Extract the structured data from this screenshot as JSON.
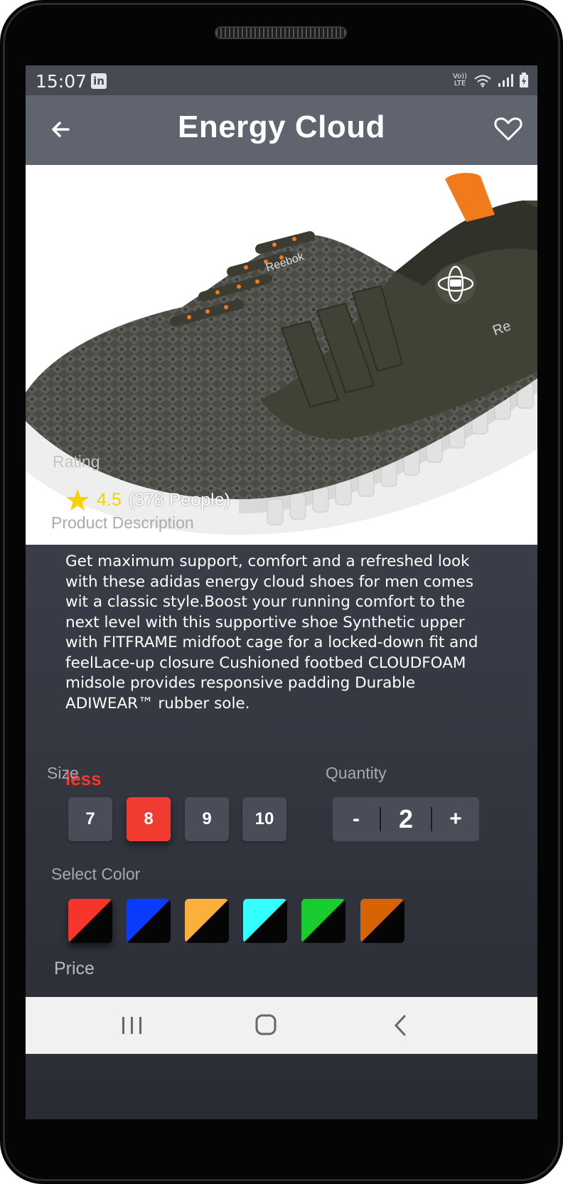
{
  "status_bar": {
    "time": "15:07",
    "linkedin_icon": "linkedin-icon",
    "icons": [
      "volte-icon",
      "wifi-icon",
      "signal-icon",
      "battery-charging-icon"
    ],
    "volte_text": "Vo)) LTE"
  },
  "appbar": {
    "title": "Energy Cloud",
    "back_icon": "arrow-left-icon",
    "favorite_icon": "heart-outline-icon"
  },
  "product": {
    "rating_label": "Rating",
    "rating_value": "4.5",
    "rating_count": "(378 People)",
    "description_label": "Product Description",
    "description": "Get maximum support, comfort and a refreshed look with these adidas energy cloud shoes for men comes wit a classic style.Boost your running comfort to the next level with this supportive shoe Synthetic upper with FITFRAME midfoot cage for a locked-down fit and feelLace-up closure Cushioned footbed CLOUDFOAM midsole provides responsive padding Durable ADIWEAR™ rubber sole.",
    "less_label": "less"
  },
  "size": {
    "label": "Size",
    "options": [
      "7",
      "8",
      "9",
      "10"
    ],
    "selected": "8"
  },
  "quantity": {
    "label": "Quantity",
    "minus": "-",
    "value": "2",
    "plus": "+"
  },
  "color": {
    "label": "Select Color",
    "swatches": [
      "#f5352c",
      "#0a3cff",
      "#fbb03b",
      "#33ffff",
      "#16cc2e",
      "#d86304"
    ],
    "selected_index": 0
  },
  "price": {
    "label": "Price"
  },
  "accent_color": "#f23b30",
  "navbar": {
    "icons": [
      "recent-apps-icon",
      "home-icon",
      "back-chevron-icon"
    ]
  }
}
